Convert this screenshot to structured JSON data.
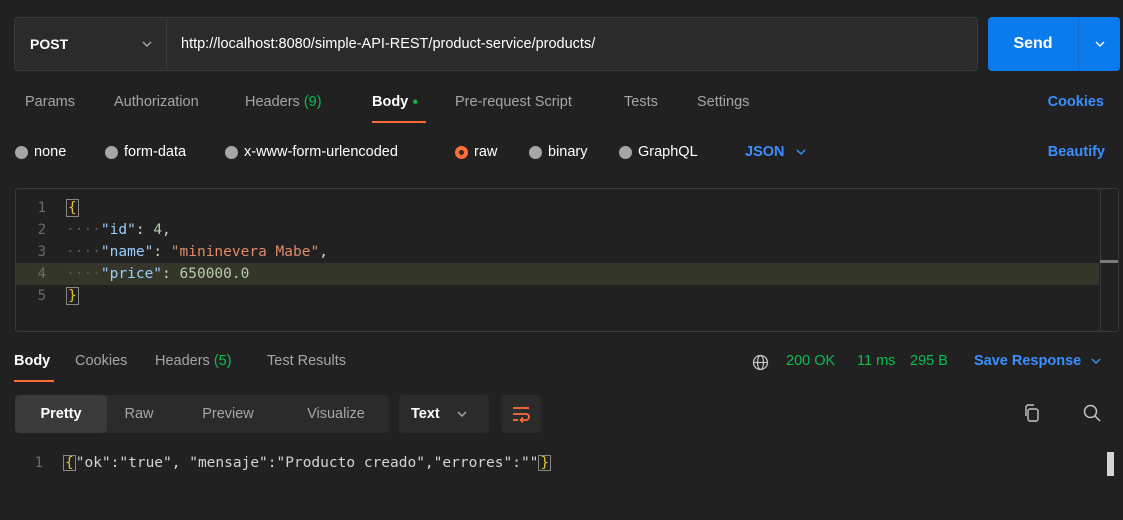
{
  "request": {
    "method": "POST",
    "url": "http://localhost:8080/simple-API-REST/product-service/products/",
    "send_label": "Send"
  },
  "request_tabs": {
    "params": "Params",
    "authorization": "Authorization",
    "headers": "Headers",
    "headers_count": "(9)",
    "body": "Body",
    "pre_request": "Pre-request Script",
    "tests": "Tests",
    "settings": "Settings",
    "cookies": "Cookies"
  },
  "body_types": {
    "none": "none",
    "form_data": "form-data",
    "urlencoded": "x-www-form-urlencoded",
    "raw": "raw",
    "binary": "binary",
    "graphql": "GraphQL",
    "selected_format": "JSON",
    "beautify": "Beautify"
  },
  "editor": {
    "lines": [
      {
        "num": "1",
        "open": "{"
      },
      {
        "num": "2",
        "key": "\"id\"",
        "value": "4"
      },
      {
        "num": "3",
        "key": "\"name\"",
        "value": "\"mininevera Mabe\""
      },
      {
        "num": "4",
        "key": "\"price\"",
        "value": "650000.0"
      },
      {
        "num": "5",
        "close": "}"
      }
    ]
  },
  "response_tabs": {
    "body": "Body",
    "cookies": "Cookies",
    "headers": "Headers",
    "headers_count": "(5)",
    "test_results": "Test Results"
  },
  "response_status": {
    "status": "200 OK",
    "time": "11 ms",
    "size": "295 B",
    "save": "Save Response"
  },
  "response_view": {
    "pretty": "Pretty",
    "raw": "Raw",
    "preview": "Preview",
    "visualize": "Visualize",
    "format": "Text"
  },
  "response_body": {
    "line_num": "1",
    "text": "\"ok\":\"true\", \"mensaje\":\"Producto creado\",\"errores\":\"\""
  },
  "colors": {
    "accent_orange": "#ff6c37",
    "link_blue": "#3a8fff",
    "send_blue": "#097bed",
    "success_green": "#0cbb52"
  }
}
